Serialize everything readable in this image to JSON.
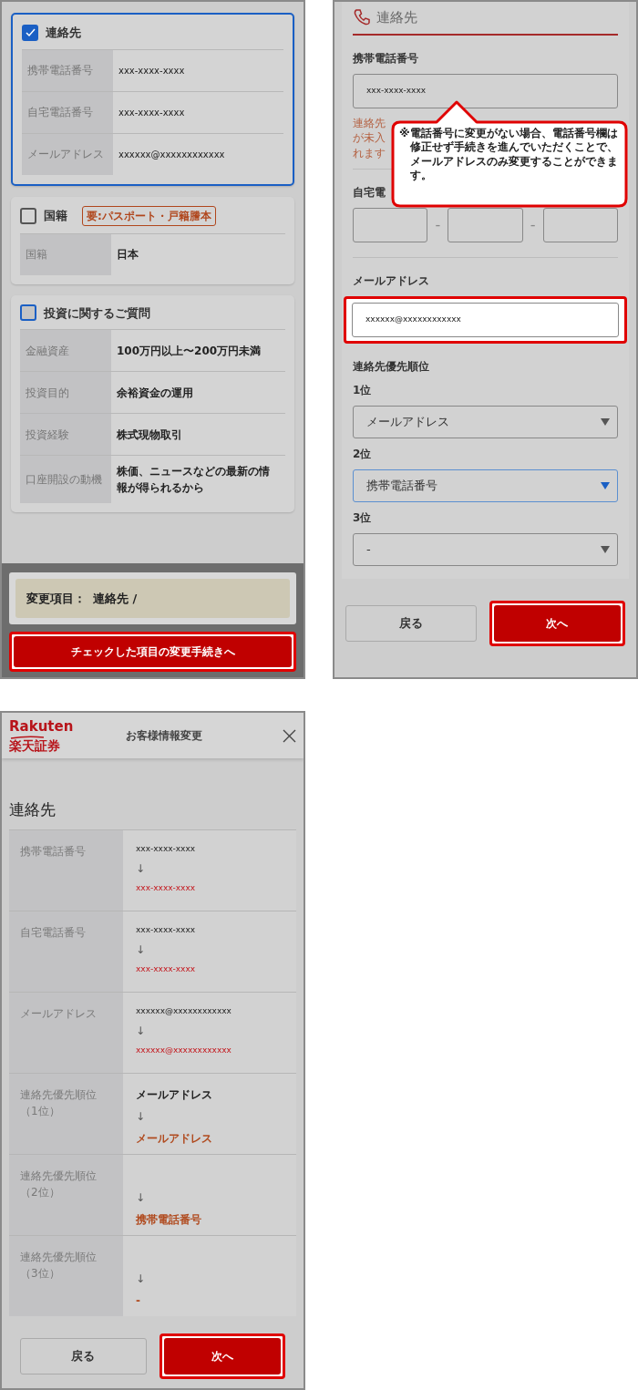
{
  "screen_1": {
    "sections": [
      {
        "title": "連絡先",
        "checked": true,
        "disabled": false,
        "kind": "small",
        "rows": [
          {
            "label": "携帯電話番号",
            "value": "xxx-xxxx-xxxx"
          },
          {
            "label": "自宅電話番号",
            "value": "xxx-xxxx-xxxx"
          },
          {
            "label": "メールアドレス",
            "value": "xxxxxx@xxxxxxxxxxxx"
          }
        ]
      },
      {
        "title": "国籍",
        "checked": false,
        "disabled": false,
        "badge": "要:パスポート・戸籍謄本",
        "kind": "bold",
        "rows": [
          {
            "label": "国籍",
            "value": "日本"
          }
        ]
      },
      {
        "title": "投資に関するご質問",
        "checked": false,
        "disabled": true,
        "kind": "bold",
        "rows": [
          {
            "label": "金融資産",
            "value": "100万円以上〜200万円未満"
          },
          {
            "label": "投資目的",
            "value": "余裕資金の運用"
          },
          {
            "label": "投資経験",
            "value": "株式現物取引"
          },
          {
            "label": "口座開設の動機",
            "value": "株価、ニュースなどの最新の情報が得られるから"
          }
        ]
      }
    ],
    "summary": {
      "label": "変更項目：",
      "value": "連絡先 /"
    },
    "submit_button": {
      "label": "チェックした項目の変更手続きへ",
      "highlighted": true
    }
  },
  "screen_2": {
    "title": "連絡先",
    "mobile": {
      "label": "携帯電話番号",
      "value": "xxx-xxxx-xxxx",
      "hint_lines": [
        "連絡先",
        "が未入",
        "れます"
      ]
    },
    "callout": "※電話番号に変更がない場合、電話番号欄は修正せず手続きを進んでいただくことで、メールアドレスのみ変更することができます。",
    "home": {
      "label": "自宅電",
      "separators": [
        "-",
        "-"
      ]
    },
    "email": {
      "label": "メールアドレス",
      "value": "xxxxxx@xxxxxxxxxxxx",
      "highlighted": true
    },
    "priority": {
      "title": "連絡先優先順位",
      "selects": [
        {
          "label": "1位",
          "value": "メールアドレス",
          "focused": false
        },
        {
          "label": "2位",
          "value": "携帯電話番号",
          "focused": true
        },
        {
          "label": "3位",
          "value": "-",
          "focused": false
        }
      ]
    },
    "buttons": [
      {
        "label": "戻る",
        "kind": "secondary",
        "highlighted": false
      },
      {
        "label": "次へ",
        "kind": "primary",
        "highlighted": true
      }
    ]
  },
  "screen_3": {
    "header": {
      "logo": "Rakuten",
      "logo_sub": "楽天証券",
      "title": "お客様情報変更"
    },
    "section_title": "連絡先",
    "rows": [
      {
        "label": "携帯電話番号",
        "old": "xxx-xxxx-xxxx",
        "arrow": "↓",
        "new": "xxx-xxxx-xxxx",
        "kind": "contact"
      },
      {
        "label": "自宅電話番号",
        "old": "xxx-xxxx-xxxx",
        "arrow": "↓",
        "new": "xxx-xxxx-xxxx",
        "kind": "contact"
      },
      {
        "label": "メールアドレス",
        "old": "xxxxxx@xxxxxxxxxxxx",
        "arrow": "↓",
        "new": "xxxxxx@xxxxxxxxxxxx",
        "kind": "contact"
      },
      {
        "label": "連絡先優先順位",
        "label_note": "（1位）",
        "old": "メールアドレス",
        "arrow": "↓",
        "new": "メールアドレス",
        "kind": "priority"
      },
      {
        "label": "連絡先優先順位",
        "label_note": "（2位）",
        "arrow": "↓",
        "new": "携帯電話番号",
        "kind": "priority"
      },
      {
        "label": "連絡先優先順位",
        "label_note": "（3位）",
        "arrow": "↓",
        "new": "-",
        "kind": "priority"
      }
    ],
    "buttons": [
      {
        "label": "戻る",
        "kind": "secondary",
        "highlighted": false
      },
      {
        "label": "次へ",
        "kind": "primary",
        "highlighted": true
      }
    ]
  }
}
